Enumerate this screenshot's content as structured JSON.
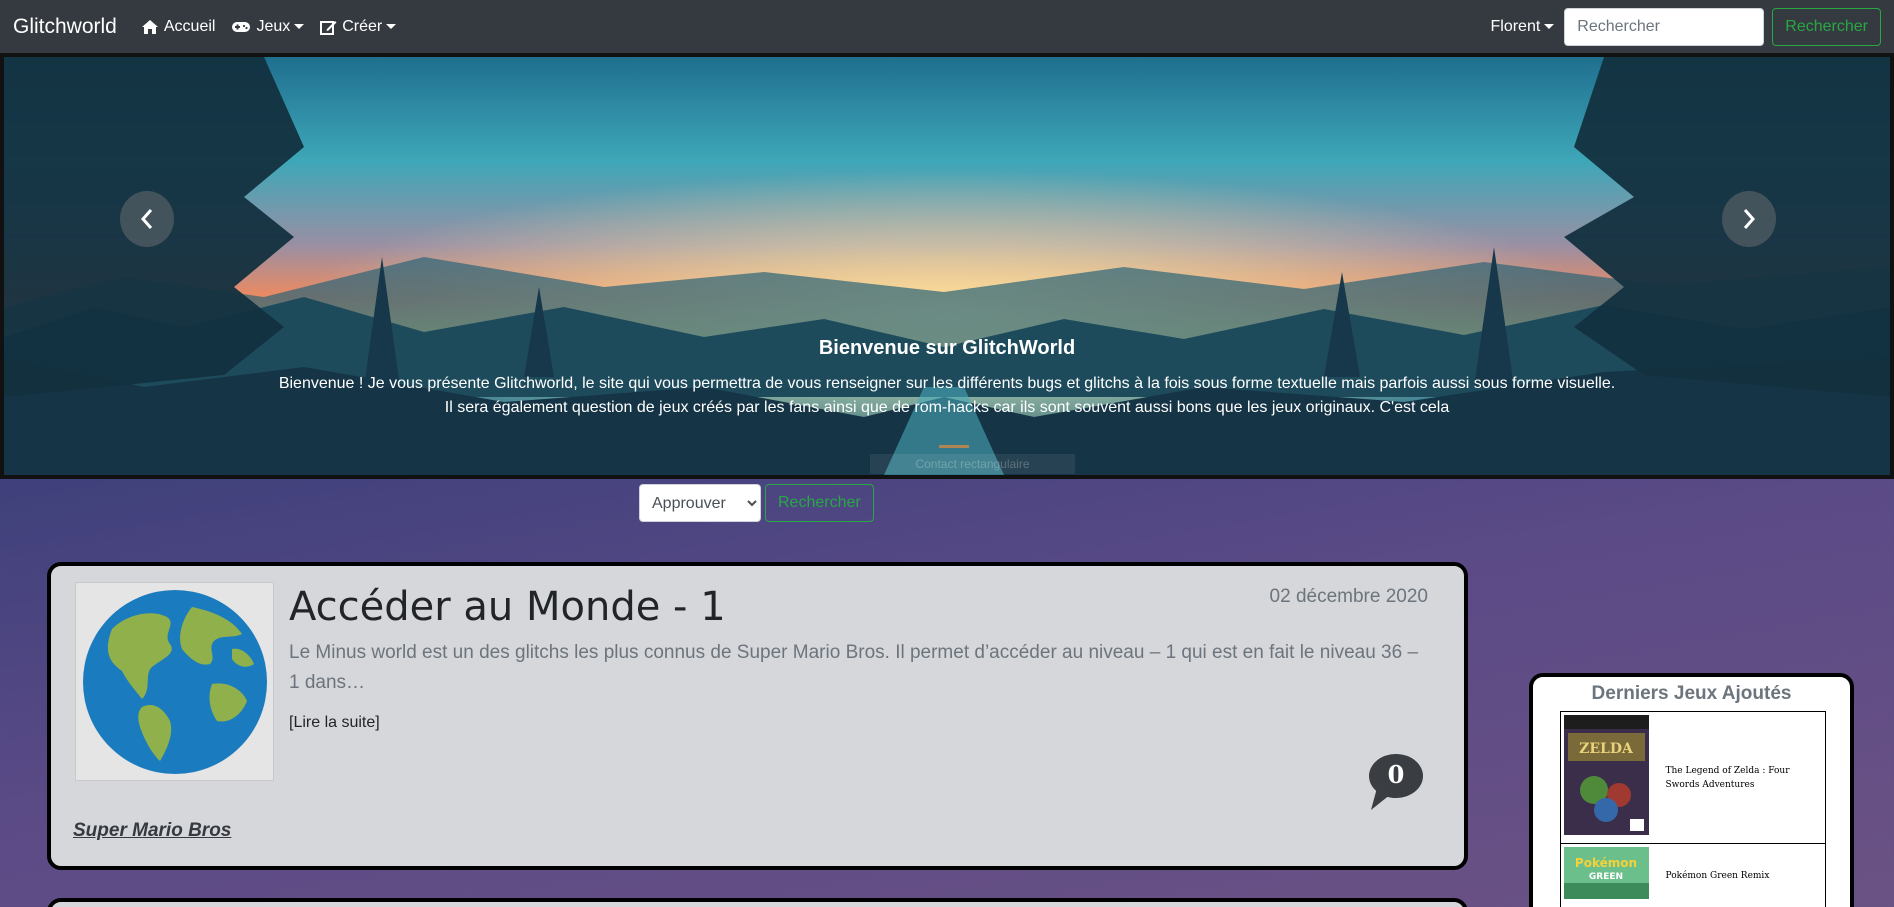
{
  "navbar": {
    "brand": "Glitchworld",
    "items": [
      {
        "label": "Accueil",
        "icon": "home-icon"
      },
      {
        "label": "Jeux",
        "icon": "gamepad-icon"
      },
      {
        "label": "Créer",
        "icon": "edit-icon"
      }
    ],
    "user": "Florent",
    "search_placeholder": "Rechercher",
    "search_button": "Rechercher"
  },
  "carousel": {
    "title": "Bienvenue sur GlitchWorld",
    "line1": "Bienvenue ! Je vous présente Glitchworld, le site qui vous permettra de vous renseigner sur les différents bugs et glitchs à la fois sous forme textuelle mais parfois aussi sous forme visuelle.",
    "line2": "Il sera également question de jeux créés par les fans ainsi que de rom-hacks car ils sont souvent aussi bons que les jeux originaux. C'est cela",
    "faded_label": "Contact rectangulaire"
  },
  "filter": {
    "selected": "Approuver",
    "button": "Rechercher"
  },
  "article": {
    "title": "Accéder au Monde - 1",
    "date": "02 décembre 2020",
    "excerpt": "Le Minus world est un des glitchs les plus connus de Super Mario Bros. Il permet d’accéder au niveau – 1 qui est en fait le niveau 36 – 1 dans…",
    "read_more": "[Lire la suite]",
    "comment_count": "0",
    "game": "Super Mario Bros",
    "thumb_icon": "globe-icon"
  },
  "sidebar": {
    "title": "Derniers Jeux Ajoutés",
    "games": [
      {
        "name": "The Legend of Zelda : Four Swords Adventures"
      },
      {
        "name": "Pokémon Green Remix"
      }
    ]
  },
  "colors": {
    "navbar": "#343a40",
    "success": "#28a745",
    "card": "#d6d7da"
  }
}
